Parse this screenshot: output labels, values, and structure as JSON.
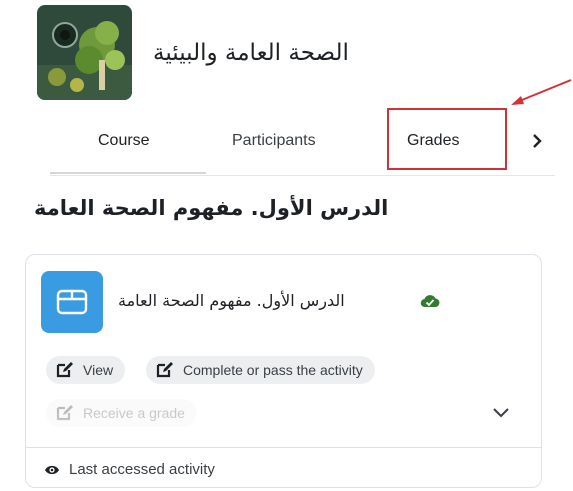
{
  "course": {
    "title": "الصحة العامة والبيئية",
    "image_icon": "course-thumbnail-plants"
  },
  "tabs": {
    "items": [
      {
        "label": "Course",
        "active": true
      },
      {
        "label": "Participants",
        "active": false
      },
      {
        "label": "Grades",
        "active": false,
        "highlighted": true
      }
    ],
    "next_icon": "chevron-right-icon"
  },
  "section": {
    "title": "الدرس الأول. مفهوم الصحة العامة"
  },
  "activity": {
    "icon": "page-icon",
    "name": "الدرس الأول. مفهوم الصحة العامة",
    "status_icon": "check-cloud-icon",
    "conditions": [
      {
        "label": "View",
        "icon": "edit-icon"
      },
      {
        "label": "Complete or pass the activity",
        "icon": "edit-icon"
      },
      {
        "label": "Receive a grade",
        "icon": "edit-icon"
      }
    ],
    "expand_icon": "chevron-down-icon",
    "footer_label": "Last accessed activity",
    "footer_icon": "eye-icon"
  },
  "colors": {
    "accent_blue": "#399be2",
    "highlight_red": "#d03236",
    "success_green": "#357a32"
  }
}
